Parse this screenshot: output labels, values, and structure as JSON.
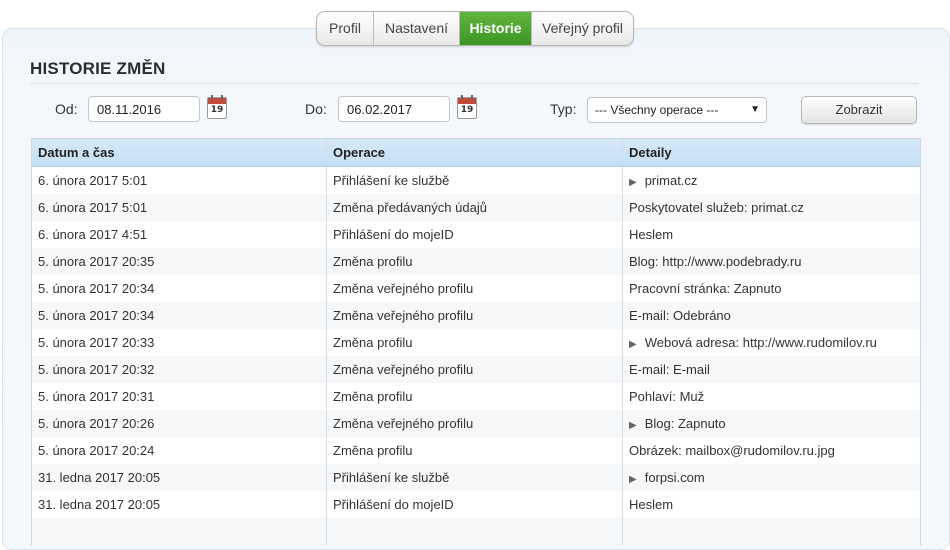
{
  "tabs": [
    {
      "label": "Profil",
      "active": false
    },
    {
      "label": "Nastavení",
      "active": false
    },
    {
      "label": "Historie",
      "active": true
    },
    {
      "label": "Veřejný profil",
      "active": false
    }
  ],
  "title": "HISTORIE ZMĚN",
  "filters": {
    "from_label": "Od:",
    "from_value": "08.11.2016",
    "to_label": "Do:",
    "to_value": "06.02.2017",
    "calendar_day": "19",
    "type_label": "Typ:",
    "type_selected": "--- Všechny operace ---",
    "submit_label": "Zobrazit"
  },
  "table": {
    "headers": [
      "Datum a čas",
      "Operace",
      "Detaily"
    ],
    "rows": [
      {
        "date": "6. února 2017 5:01",
        "operation": "Přihlášení ke službě",
        "detail": "primat.cz",
        "expandable": true
      },
      {
        "date": "6. února 2017 5:01",
        "operation": "Změna předávaných údajů",
        "detail": "Poskytovatel služeb: primat.cz",
        "expandable": false
      },
      {
        "date": "6. února 2017 4:51",
        "operation": "Přihlášení do mojeID",
        "detail": "Heslem",
        "expandable": false
      },
      {
        "date": "5. února 2017 20:35",
        "operation": "Změna profilu",
        "detail": "Blog: http://www.podebrady.ru",
        "expandable": false
      },
      {
        "date": "5. února 2017 20:34",
        "operation": "Změna veřejného profilu",
        "detail": "Pracovní stránka: Zapnuto",
        "expandable": false
      },
      {
        "date": "5. února 2017 20:34",
        "operation": "Změna veřejného profilu",
        "detail": "E-mail: Odebráno",
        "expandable": false
      },
      {
        "date": "5. února 2017 20:33",
        "operation": "Změna profilu",
        "detail": "Webová adresa: http://www.rudomilov.ru",
        "expandable": true
      },
      {
        "date": "5. února 2017 20:32",
        "operation": "Změna veřejného profilu",
        "detail": "E-mail: E-mail",
        "expandable": false
      },
      {
        "date": "5. února 2017 20:31",
        "operation": "Změna profilu",
        "detail": "Pohlaví: Muž",
        "expandable": false
      },
      {
        "date": "5. února 2017 20:26",
        "operation": "Změna veřejného profilu",
        "detail": "Blog: Zapnuto",
        "expandable": true
      },
      {
        "date": "5. února 2017 20:24",
        "operation": "Změna profilu",
        "detail": "Obrázek: mailbox@rudomilov.ru.jpg",
        "expandable": false
      },
      {
        "date": "31. ledna 2017 20:05",
        "operation": "Přihlášení ke službě",
        "detail": "forpsi.com",
        "expandable": true
      },
      {
        "date": "31. ledna 2017 20:05",
        "operation": "Přihlášení do mojeID",
        "detail": "Heslem",
        "expandable": false
      },
      {
        "date": "",
        "operation": "",
        "detail": "",
        "expandable": false
      }
    ]
  },
  "colors": {
    "active_tab": "#4aa52e",
    "table_header": "#cfe5f6"
  }
}
